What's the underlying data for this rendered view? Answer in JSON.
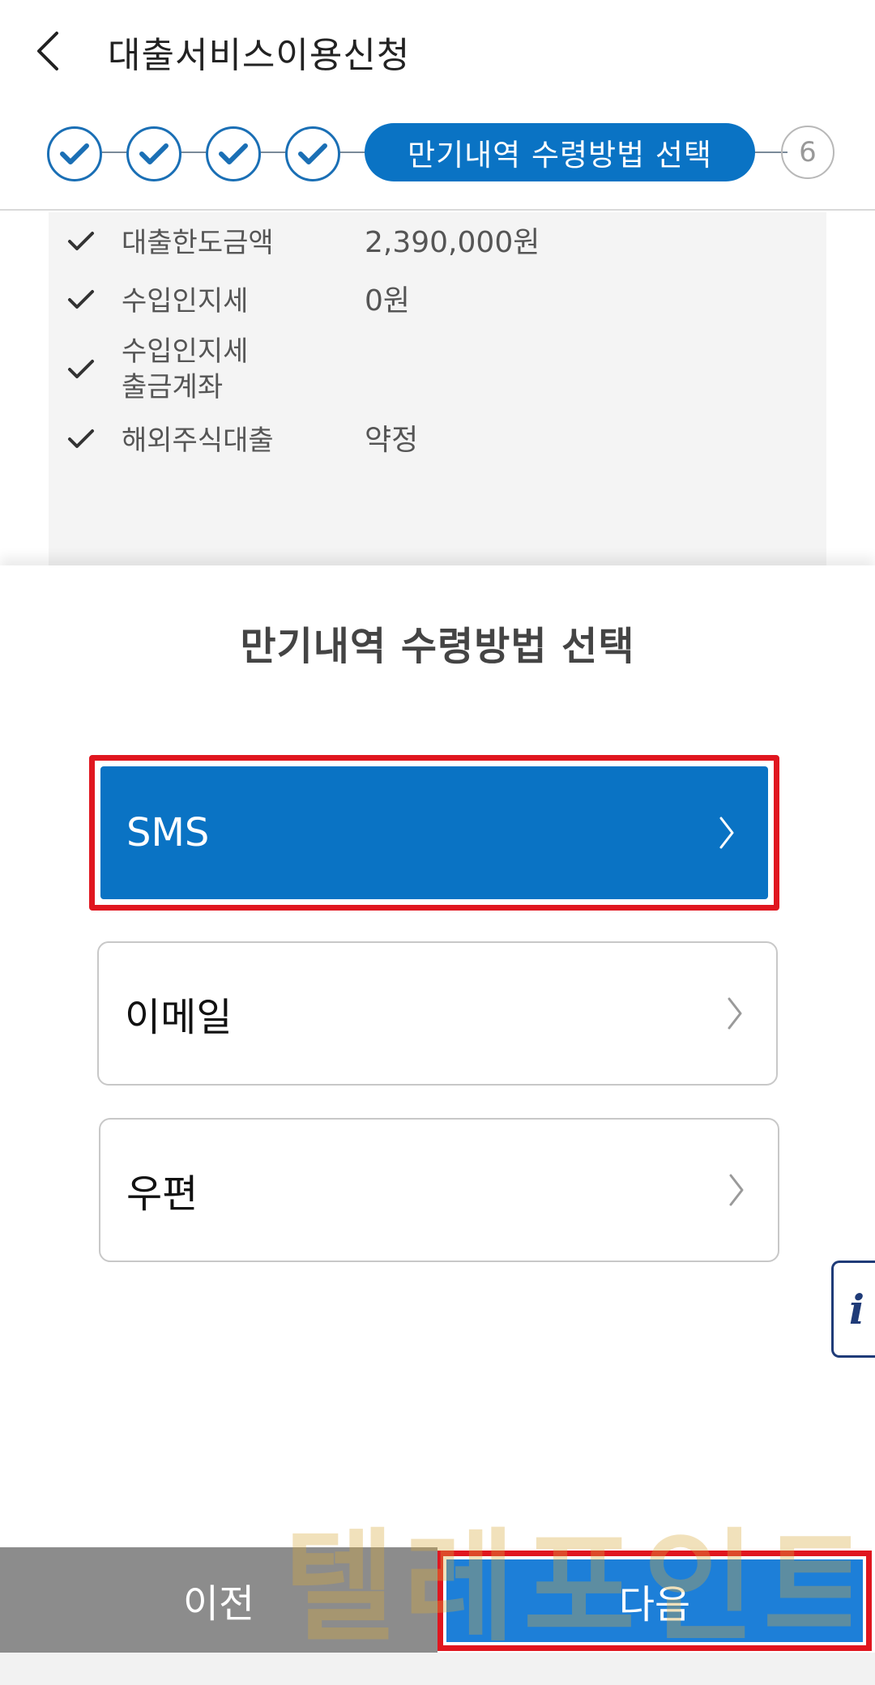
{
  "header": {
    "title": "대출서비스이용신청"
  },
  "stepper": {
    "completed_count": 4,
    "current_label": "만기내역 수령방법 선택",
    "next_step_number": "6"
  },
  "summary": {
    "rows": [
      {
        "label": "대출한도금액",
        "value": "2,390,000원"
      },
      {
        "label": "수입인지세",
        "value": "0원"
      },
      {
        "label": "수입인지세\n출금계좌",
        "value": ""
      },
      {
        "label": "해외주식대출",
        "value": "약정"
      }
    ]
  },
  "sheet": {
    "title": "만기내역 수령방법 선택",
    "options": [
      {
        "label": "SMS",
        "selected": true
      },
      {
        "label": "이메일",
        "selected": false
      },
      {
        "label": "우편",
        "selected": false
      }
    ]
  },
  "info_button": {
    "label": "i"
  },
  "bottom_bar": {
    "prev_label": "이전",
    "next_label": "다음"
  },
  "watermark": {
    "text": "텔레포인트"
  },
  "colors": {
    "primary_blue": "#0a73c4",
    "next_blue": "#1d7fd8",
    "highlight_red": "#e0161f",
    "prev_gray": "#8c8c8c"
  }
}
